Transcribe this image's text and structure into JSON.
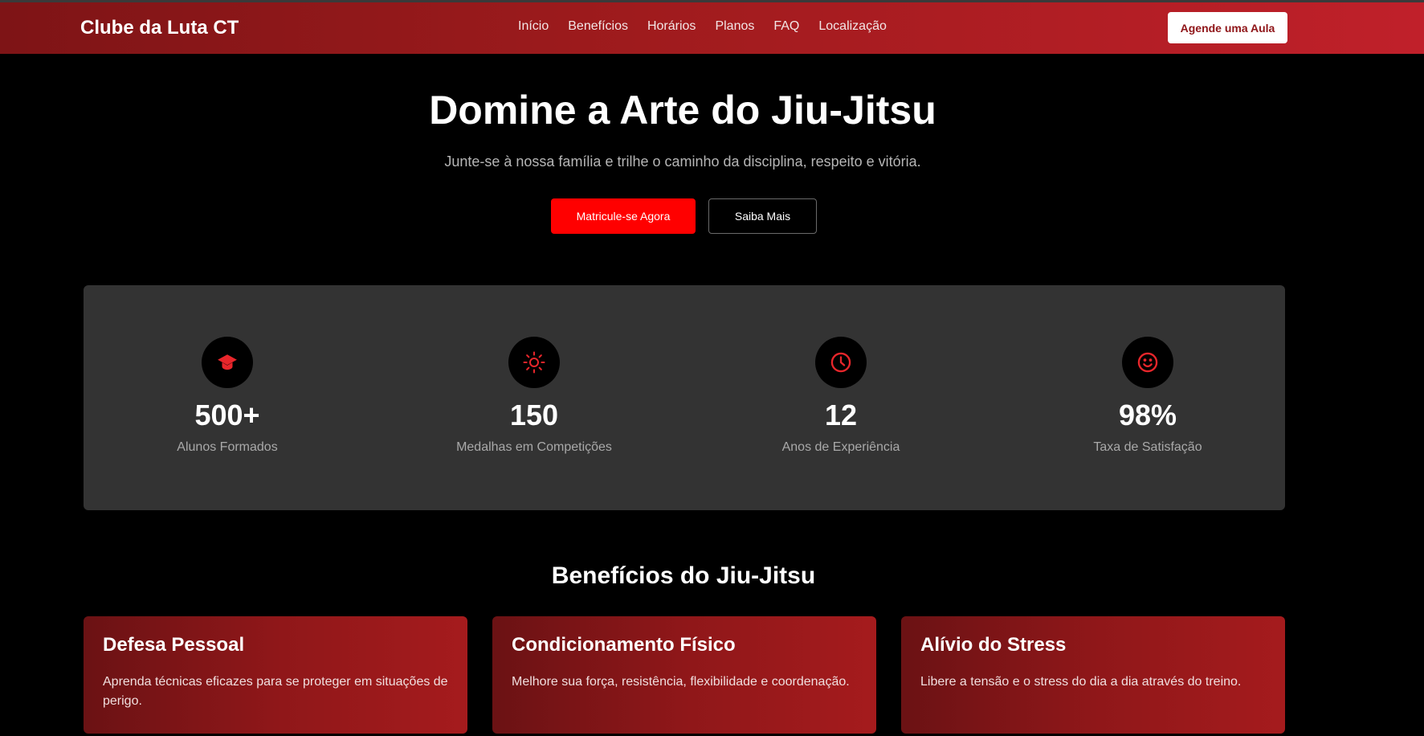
{
  "nav": {
    "brand": "Clube da Luta CT",
    "links": [
      "Início",
      "Benefícios",
      "Horários",
      "Planos",
      "FAQ",
      "Localização"
    ],
    "cta": "Agende uma Aula"
  },
  "hero": {
    "title": "Domine a Arte do Jiu-Jitsu",
    "subtitle": "Junte-se à nossa família e trilhe o caminho da disciplina, respeito e vitória.",
    "primary_button": "Matricule-se Agora",
    "secondary_button": "Saiba Mais"
  },
  "stats": [
    {
      "icon": "graduation-cap-icon",
      "value": "500+",
      "label": "Alunos Formados"
    },
    {
      "icon": "sun-icon",
      "value": "150",
      "label": "Medalhas em Competições"
    },
    {
      "icon": "clock-icon",
      "value": "12",
      "label": "Anos de Experiência"
    },
    {
      "icon": "smile-icon",
      "value": "98%",
      "label": "Taxa de Satisfação"
    }
  ],
  "benefits": {
    "title": "Benefícios do Jiu-Jitsu",
    "cards": [
      {
        "title": "Defesa Pessoal",
        "text": "Aprenda técnicas eficazes para se proteger em situações de perigo."
      },
      {
        "title": "Condicionamento Físico",
        "text": "Melhore sua força, resistência, flexibilidade e coordenação."
      },
      {
        "title": "Alívio do Stress",
        "text": "Libere a tensão e o stress do dia a dia através do treino."
      }
    ]
  },
  "colors": {
    "accent": "#ff0000",
    "icon_red": "#e8262b",
    "nav_gradient_start": "#7e1416",
    "nav_gradient_end": "#c0202a",
    "stats_panel": "#333333"
  }
}
